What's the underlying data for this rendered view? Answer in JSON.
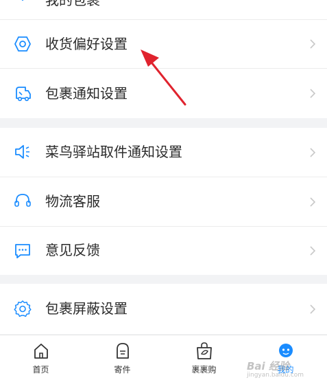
{
  "colors": {
    "accent": "#1a8cff",
    "arrow": "#e0232e",
    "icon": "#1a8cff",
    "chevron": "#c8c8c8"
  },
  "menu": {
    "top_partial_label": "我的包裹",
    "items": [
      {
        "icon": "hexagon-nut-icon",
        "label": "收货偏好设置"
      },
      {
        "icon": "delivery-truck-icon",
        "label": "包裹通知设置"
      },
      {
        "icon": "speaker-icon",
        "label": "菜鸟驿站取件通知设置"
      },
      {
        "icon": "headset-icon",
        "label": "物流客服"
      },
      {
        "icon": "chat-bubble-icon",
        "label": "意见反馈"
      },
      {
        "icon": "gear-icon",
        "label": "包裹屏蔽设置"
      }
    ]
  },
  "tabbar": {
    "tabs": [
      {
        "icon": "home-icon",
        "label": "首页"
      },
      {
        "icon": "parcel-bag-icon",
        "label": "寄件"
      },
      {
        "icon": "shopping-bag-icon",
        "label": "裹裹购"
      },
      {
        "icon": "profile-icon",
        "label": "我的",
        "active": true
      }
    ]
  },
  "watermark": {
    "line1": "Bai 经验",
    "line2": "jingyan.baidu.com"
  }
}
